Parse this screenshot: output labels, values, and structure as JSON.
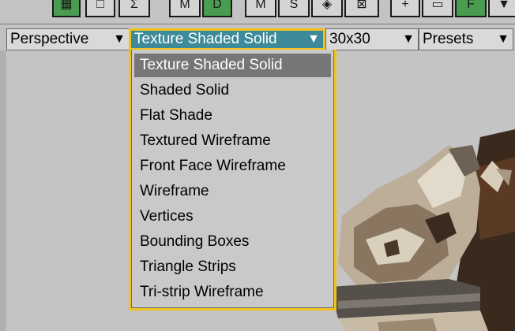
{
  "toolbar": {
    "buttons": [
      {
        "id": "t1",
        "glyph": "▦"
      },
      {
        "id": "t2",
        "glyph": "□"
      },
      {
        "id": "t3",
        "glyph": "Σ"
      },
      {
        "id": "t4",
        "glyph": "M"
      },
      {
        "id": "t5",
        "glyph": "D"
      },
      {
        "id": "t6",
        "glyph": "M"
      },
      {
        "id": "t7",
        "glyph": "S"
      },
      {
        "id": "t8",
        "glyph": "◈"
      },
      {
        "id": "t9",
        "glyph": "⊠"
      },
      {
        "id": "t10",
        "glyph": "+"
      },
      {
        "id": "t11",
        "glyph": "▭"
      },
      {
        "id": "t12",
        "glyph": "F"
      },
      {
        "id": "t13",
        "glyph": "▼"
      }
    ]
  },
  "dropdowns": {
    "view": {
      "label": "Perspective",
      "arrow": "▼"
    },
    "shading": {
      "label": "Texture Shaded Solid",
      "arrow": "▼"
    },
    "grid": {
      "label": "30x30",
      "arrow": "▼"
    },
    "presets": {
      "label": "Presets",
      "arrow": "▼"
    }
  },
  "menu": {
    "selected_index": 0,
    "items": [
      {
        "label": "Texture Shaded Solid"
      },
      {
        "label": "Shaded Solid"
      },
      {
        "label": "Flat Shade"
      },
      {
        "label": "Textured Wireframe"
      },
      {
        "label": "Front Face Wireframe"
      },
      {
        "label": "Wireframe"
      },
      {
        "label": "Vertices"
      },
      {
        "label": "Bounding Boxes"
      },
      {
        "label": "Triangle Strips"
      },
      {
        "label": "Tri-strip Wireframe"
      }
    ]
  },
  "colors": {
    "accent_border": "#f2c21a",
    "active_dropdown": "#3d8a9a",
    "menu_selected": "#767676"
  }
}
